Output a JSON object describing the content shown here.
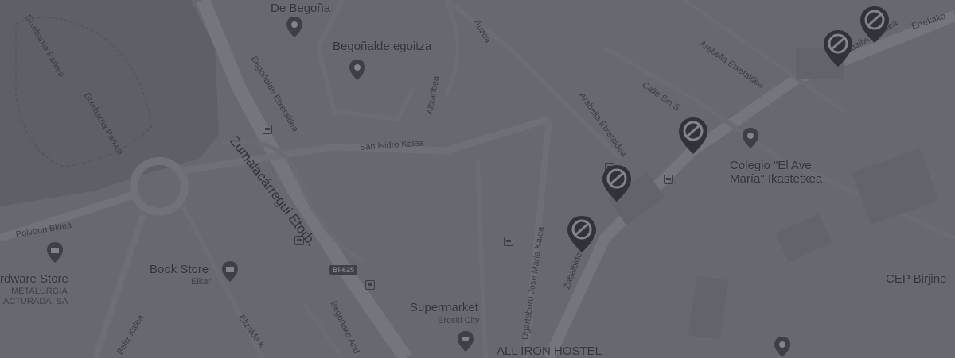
{
  "map": {
    "places": {
      "begona_top": "De Begoña",
      "begonalde": "Begoñalde egoitza",
      "colegio_line1": "Colegio \"El Ave",
      "colegio_line2": "María\" Ikastetxea",
      "book_store": "Book Store",
      "book_store_sub": "Elkar",
      "hardware_store": "rdware Store",
      "hardware_sub1": "METALURGIA",
      "hardware_sub2": "ACTURADA, SA",
      "supermarket": "Supermarket",
      "supermarket_sub": "Eroski City",
      "hostel": "ALL IRON HOSTEL",
      "cep": "CEP Birjine"
    },
    "streets": {
      "zumalacarregui": "Zumalacárregui Etorb.",
      "san_isidro": "San Isidro Kalea",
      "begonalde_etx": "Begoñalde Etxetaldea",
      "polvorin": "Polvorin Bidea",
      "etxebarria_top": "Etxebarria Parkea",
      "etxebarria": "Etxebarria Parkea",
      "altxaribe": "Altxaribea",
      "auzoa": "Auzoa",
      "arabella_1": "Arabella Etxetaldea",
      "arabella_2": "Arabella Etxetaldea",
      "calle_sin": "Calle Sin S",
      "zabalbide_top": "Zabalbide Kalea",
      "errekako": "Errekako",
      "ugarteburu": "Ugarteburu Jose María Kalea",
      "zabalbide_bottom": "Zabalbide Kalea",
      "begonako_and": "Begoñako And",
      "elizalde": "Elizalde K",
      "beitz": "Beitz Kalea"
    },
    "road_shield": "BI-625"
  }
}
